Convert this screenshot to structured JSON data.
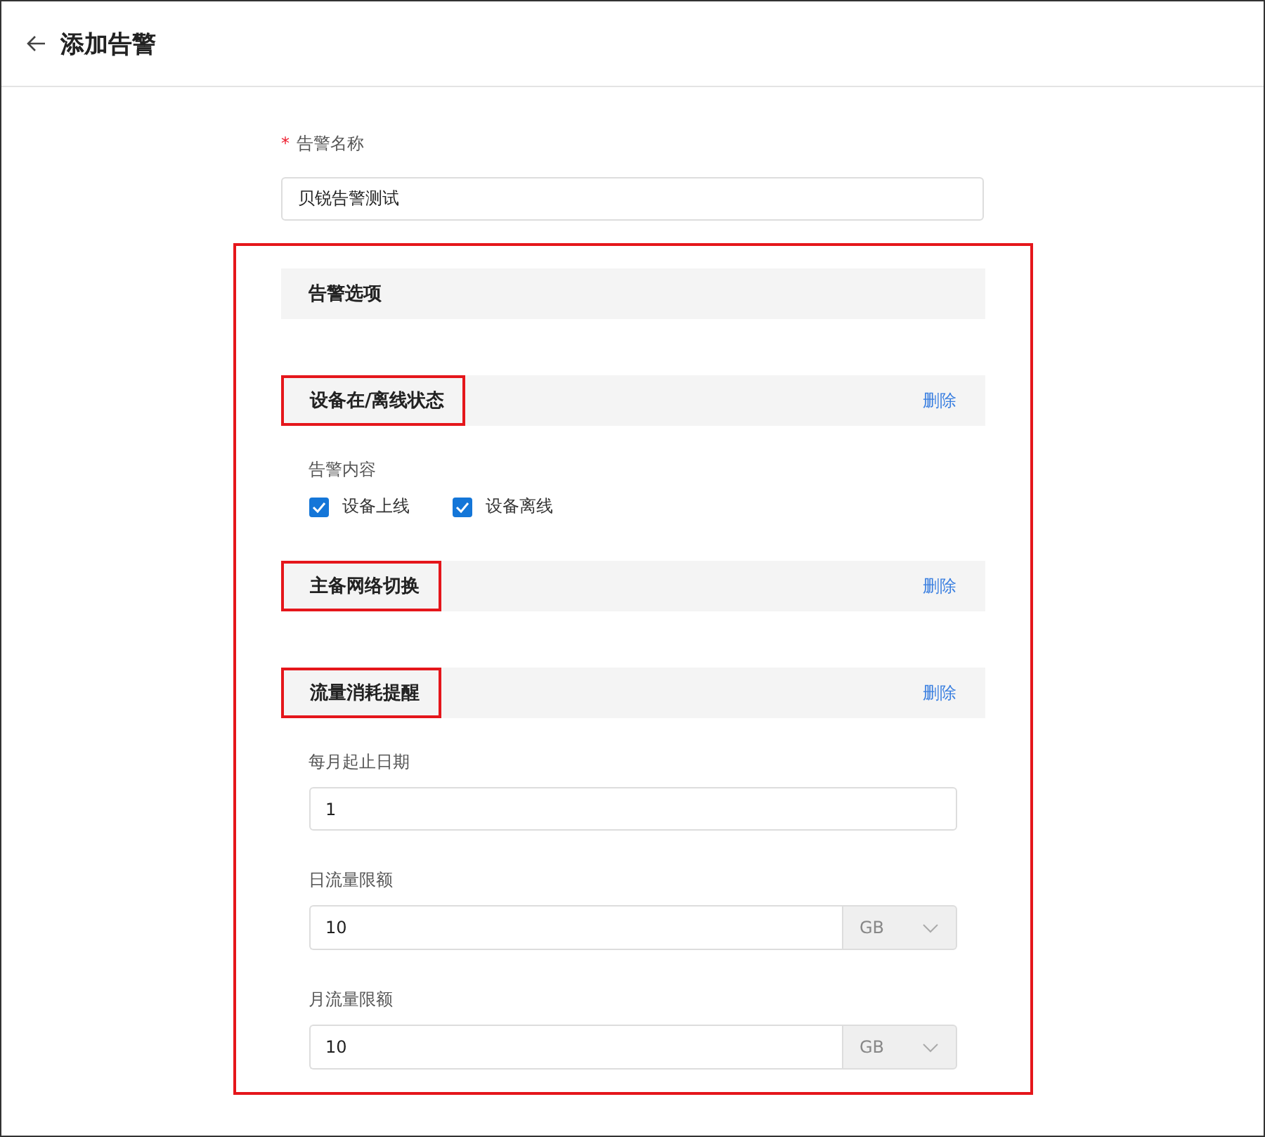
{
  "header": {
    "title": "添加告警"
  },
  "name_field": {
    "required_mark": "*",
    "label": "告警名称",
    "value": "贝锐告警测试"
  },
  "options": {
    "title": "告警选项",
    "highlighted": true,
    "sections": [
      {
        "title": "设备在/离线状态",
        "highlighted": true,
        "delete_label": "删除",
        "kind": "checkboxes",
        "group_label": "告警内容",
        "checkboxes": [
          {
            "label": "设备上线",
            "checked": true
          },
          {
            "label": "设备离线",
            "checked": true
          }
        ]
      },
      {
        "title": "主备网络切换",
        "highlighted": true,
        "delete_label": "删除",
        "kind": "empty"
      },
      {
        "title": "流量消耗提醒",
        "highlighted": true,
        "delete_label": "删除",
        "kind": "fields",
        "fields": [
          {
            "kind": "text",
            "label": "每月起止日期",
            "value": "1"
          },
          {
            "kind": "unit",
            "label": "日流量限额",
            "value": "10",
            "unit": "GB"
          },
          {
            "kind": "unit",
            "label": "月流量限额",
            "value": "10",
            "unit": "GB"
          }
        ]
      }
    ]
  }
}
